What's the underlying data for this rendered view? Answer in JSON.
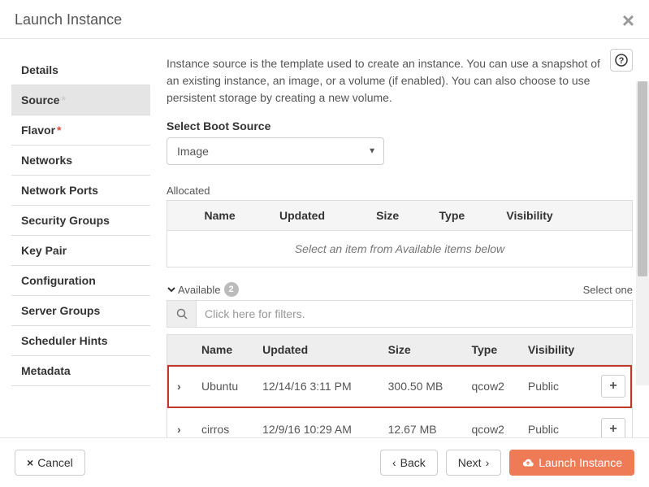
{
  "header": {
    "title": "Launch Instance"
  },
  "sidebar": {
    "items": [
      {
        "label": "Details",
        "active": false,
        "required": false
      },
      {
        "label": "Source",
        "active": true,
        "required": "grey"
      },
      {
        "label": "Flavor",
        "active": false,
        "required": "red"
      },
      {
        "label": "Networks",
        "active": false,
        "required": false
      },
      {
        "label": "Network Ports",
        "active": false,
        "required": false
      },
      {
        "label": "Security Groups",
        "active": false,
        "required": false
      },
      {
        "label": "Key Pair",
        "active": false,
        "required": false
      },
      {
        "label": "Configuration",
        "active": false,
        "required": false
      },
      {
        "label": "Server Groups",
        "active": false,
        "required": false
      },
      {
        "label": "Scheduler Hints",
        "active": false,
        "required": false
      },
      {
        "label": "Metadata",
        "active": false,
        "required": false
      }
    ]
  },
  "main": {
    "description": "Instance source is the template used to create an instance. You can use a snapshot of an existing instance, an image, or a volume (if enabled). You can also choose to use persistent storage by creating a new volume.",
    "boot_label": "Select Boot Source",
    "boot_value": "Image",
    "allocated": {
      "label": "Allocated",
      "columns": {
        "name": "Name",
        "updated": "Updated",
        "size": "Size",
        "type": "Type",
        "visibility": "Visibility"
      },
      "empty": "Select an item from Available items below"
    },
    "available": {
      "label": "Available",
      "count": "2",
      "hint": "Select one",
      "filter_placeholder": "Click here for filters.",
      "columns": {
        "name": "Name",
        "updated": "Updated",
        "size": "Size",
        "type": "Type",
        "visibility": "Visibility"
      },
      "rows": [
        {
          "name": "Ubuntu",
          "updated": "12/14/16 3:11 PM",
          "size": "300.50 MB",
          "type": "qcow2",
          "visibility": "Public",
          "highlight": true
        },
        {
          "name": "cirros",
          "updated": "12/9/16 10:29 AM",
          "size": "12.67 MB",
          "type": "qcow2",
          "visibility": "Public",
          "highlight": false
        }
      ]
    }
  },
  "footer": {
    "cancel": "Cancel",
    "back": "Back",
    "next": "Next",
    "launch": "Launch Instance"
  },
  "icons": {
    "chevron_left": "‹",
    "chevron_right": "›",
    "close": "×",
    "asterisk": "*",
    "plus": "+"
  }
}
